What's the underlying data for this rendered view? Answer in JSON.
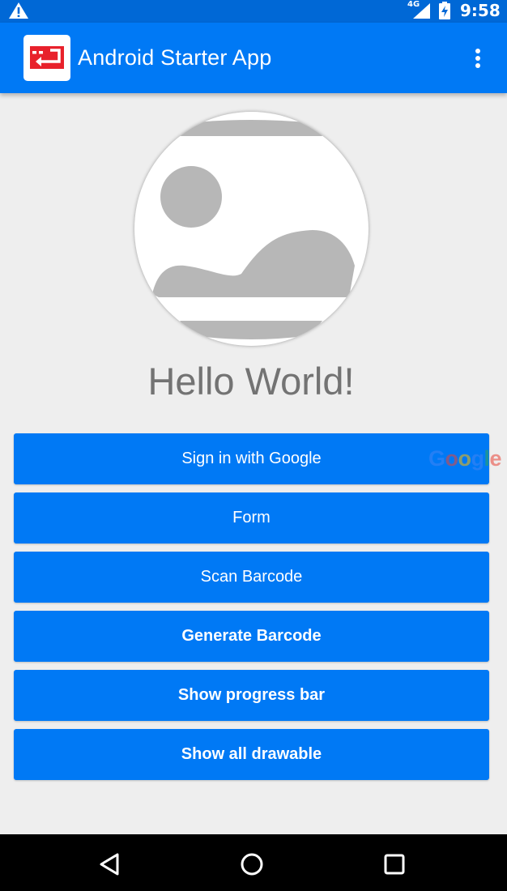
{
  "status_bar": {
    "network": "4G",
    "time": "9:58",
    "icons": [
      "warning-icon",
      "signal-icon",
      "battery-charging-icon"
    ]
  },
  "app_bar": {
    "title": "Android Starter App",
    "logo_icon": "app-logo-icon",
    "overflow_icon": "more-vert-icon"
  },
  "main": {
    "avatar_icon": "image-placeholder-icon",
    "greeting": "Hello World!",
    "buttons": [
      {
        "label": "Sign in with Google",
        "logo": "Google"
      },
      {
        "label": "Form"
      },
      {
        "label": "Scan Barcode"
      },
      {
        "label": "Generate Barcode"
      },
      {
        "label": "Show progress bar"
      },
      {
        "label": "Show all drawable"
      }
    ]
  },
  "nav_bar": {
    "icons": [
      "back-icon",
      "home-icon",
      "recents-icon"
    ]
  },
  "colors": {
    "primary": "#0079f5",
    "primary_dark": "#0068d6",
    "background": "#eeeeee",
    "logo_red": "#e8212b"
  }
}
